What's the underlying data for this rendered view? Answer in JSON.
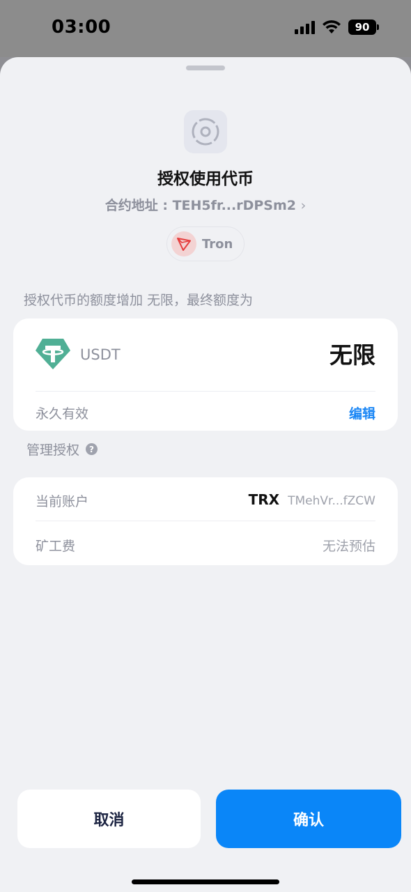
{
  "status_bar": {
    "time": "03:00",
    "battery": "90"
  },
  "header": {
    "title": "授权使用代币",
    "contract_label": "合约地址 : TEH5fr...rDPSm2",
    "chevron": "›",
    "chain_name": "Tron"
  },
  "approval": {
    "section_label": "授权代币的额度增加 无限，最终额度为",
    "token": "USDT",
    "amount": "无限",
    "validity": "永久有效",
    "edit_label": "编辑"
  },
  "manage": {
    "label": "管理授权",
    "help": "?"
  },
  "details": {
    "account_label": "当前账户",
    "account_chain": "TRX",
    "account_address": "TMehVr...fZCW",
    "fee_label": "矿工费",
    "fee_value": "无法预估"
  },
  "actions": {
    "cancel_label": "取消",
    "confirm_label": "确认"
  },
  "colors": {
    "accent": "#0a86f8",
    "link": "#1a86f5",
    "tether": "#50af95",
    "tron": "#e53e3e"
  },
  "icons": [
    "dapp-target-icon",
    "tron-logo-icon",
    "usdt-logo-icon",
    "help-icon",
    "chevron-right-icon"
  ]
}
